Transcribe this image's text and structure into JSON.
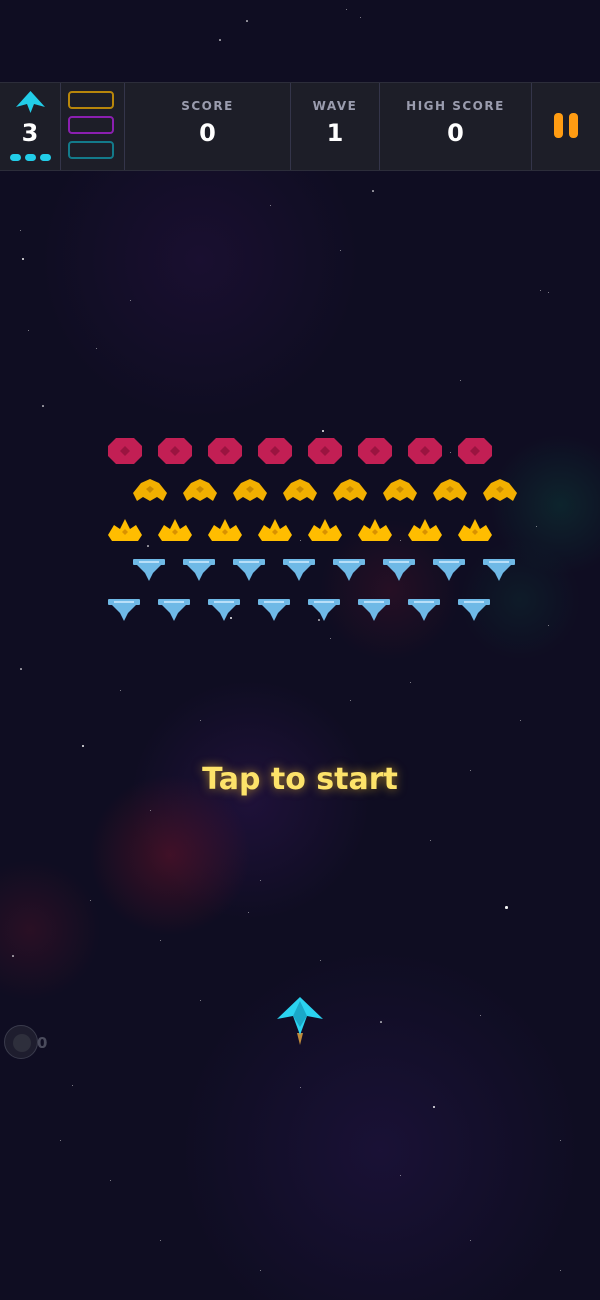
{
  "hud": {
    "lives": "3",
    "lives_pips": 3,
    "powerup_slots": [
      {
        "name": "slot-gold",
        "color": "#b8860b"
      },
      {
        "name": "slot-purple",
        "color": "#8b1fb0"
      },
      {
        "name": "slot-teal",
        "color": "#137a8a"
      }
    ],
    "score_label": "SCORE",
    "score": "0",
    "wave_label": "WAVE",
    "wave": "1",
    "high_score_label": "HIGH SCORE",
    "high_score": "0",
    "pause_icon": "pause-icon"
  },
  "formation": {
    "rows": [
      {
        "type": "crimson-blob",
        "color": "#c21f54",
        "count": 8
      },
      {
        "type": "gold-wing",
        "color": "#f2b000",
        "count": 8
      },
      {
        "type": "gold-crown",
        "color": "#ffbd00",
        "count": 8
      },
      {
        "type": "ice-drone",
        "color": "#6fb9e6",
        "count": 8
      },
      {
        "type": "ice-drone",
        "color": "#6fb9e6",
        "count": 8
      }
    ]
  },
  "message": {
    "tap_to_start": "Tap to start"
  },
  "bomb": {
    "count": "0",
    "icon": "bomb-icon"
  },
  "colors": {
    "accent_cyan": "#22cde8",
    "pause_orange": "#ff9c12",
    "prompt_yellow": "#fde36a",
    "hud_bg": "#1d1e28",
    "space_bg": "#0f0d22"
  }
}
